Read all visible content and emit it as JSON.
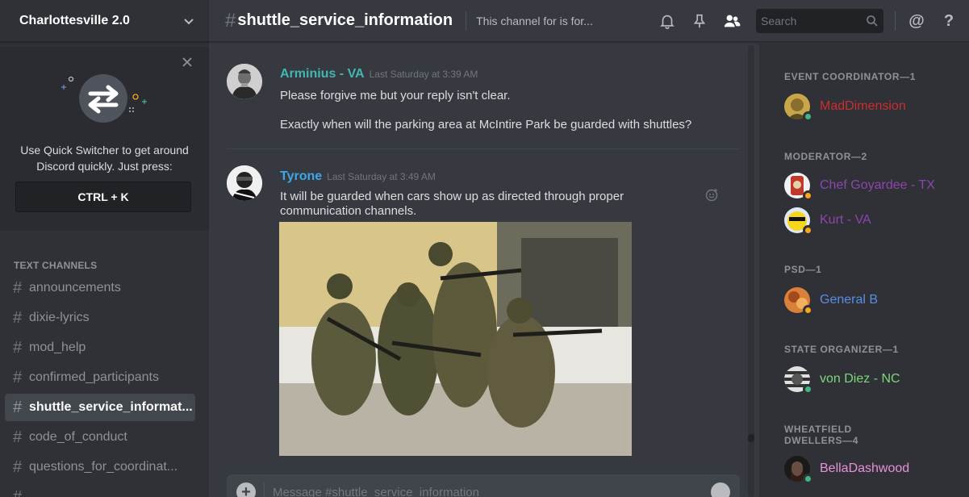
{
  "guild": {
    "name": "Charlottesville 2.0"
  },
  "quick_switcher": {
    "tip": "Use Quick Switcher to get around Discord quickly. Just press:",
    "shortcut": "CTRL + K"
  },
  "sidebar": {
    "category": "TEXT CHANNELS",
    "channels": [
      {
        "name": "announcements"
      },
      {
        "name": "dixie-lyrics"
      },
      {
        "name": "mod_help"
      },
      {
        "name": "confirmed_participants"
      },
      {
        "name": "shuttle_service_informat..."
      },
      {
        "name": "code_of_conduct"
      },
      {
        "name": "questions_for_coordinat..."
      },
      {
        "name": ""
      }
    ]
  },
  "header": {
    "hash": "#",
    "channel_name": "shuttle_service_information",
    "topic": "This channel for is for...",
    "search_placeholder": "Search",
    "mention_symbol": "@",
    "help_symbol": "?"
  },
  "messages": [
    {
      "user": "Arminius - VA",
      "user_color": "#43b6b4",
      "timestamp": "Last Saturday at 3:39 AM",
      "lines": [
        "Please forgive me but your reply isn't clear.",
        "Exactly when will the parking area at McIntire Park be guarded with shuttles?"
      ]
    },
    {
      "user": "Tyrone",
      "user_color": "#3ea7e6",
      "timestamp": "Last Saturday at 3:49 AM",
      "lines": [
        "It will be guarded when cars show up as directed through proper",
        "communication channels."
      ]
    }
  ],
  "composer": {
    "placeholder": "Message #shuttle_service_information"
  },
  "member_groups": [
    {
      "role": "EVENT COORDINATOR—1",
      "members": [
        {
          "name": "MadDimension",
          "color": "#c9302c",
          "status_color": "#43b581"
        }
      ]
    },
    {
      "role": "MODERATOR—2",
      "members": [
        {
          "name": "Chef Goyardee - TX",
          "color": "#8e44ad",
          "status_color": "#faa61a"
        },
        {
          "name": "Kurt - VA",
          "color": "#8e44ad",
          "status_color": "#faa61a"
        }
      ]
    },
    {
      "role": "PSD—1",
      "members": [
        {
          "name": "General B",
          "color": "#5b8de6",
          "status_color": "#faa61a"
        }
      ]
    },
    {
      "role": "STATE ORGANIZER—1",
      "members": [
        {
          "name": "von Diez - NC",
          "color": "#7cd67c",
          "status_color": "#43b581"
        }
      ]
    },
    {
      "role": "WHEATFIELD",
      "role2": "DWELLERS—4",
      "members": [
        {
          "name": "BellaDashwood",
          "color": "#e791d8",
          "status_color": "#43b581"
        }
      ]
    }
  ]
}
